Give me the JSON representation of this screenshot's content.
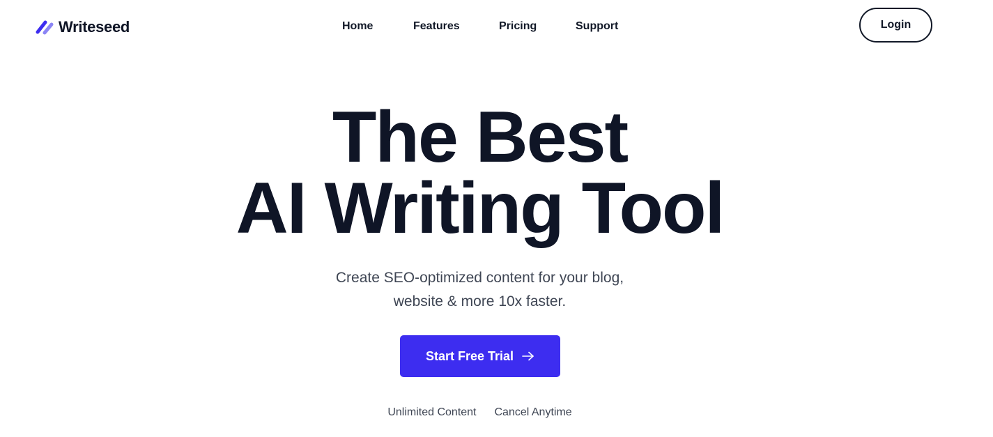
{
  "brand": {
    "name": "Writeseed",
    "logo_icon": "double-slash-logo-icon",
    "logo_colors": [
      "#3d2df0",
      "#8b85f5"
    ]
  },
  "nav": {
    "items": [
      {
        "label": "Home"
      },
      {
        "label": "Features"
      },
      {
        "label": "Pricing"
      },
      {
        "label": "Support"
      }
    ]
  },
  "header": {
    "login_label": "Login"
  },
  "hero": {
    "title_line1": "The Best",
    "title_line2": "AI Writing Tool",
    "subtitle_line1": "Create SEO-optimized content for your blog,",
    "subtitle_line2": "website & more 10x faster.",
    "cta_label": "Start Free Trial",
    "cta_icon": "arrow-right-icon",
    "perks": [
      "Unlimited Content",
      "Cancel Anytime"
    ]
  },
  "colors": {
    "accent": "#3d2df0",
    "text": "#0f1526",
    "muted": "#3f4654",
    "background": "#ffffff"
  }
}
